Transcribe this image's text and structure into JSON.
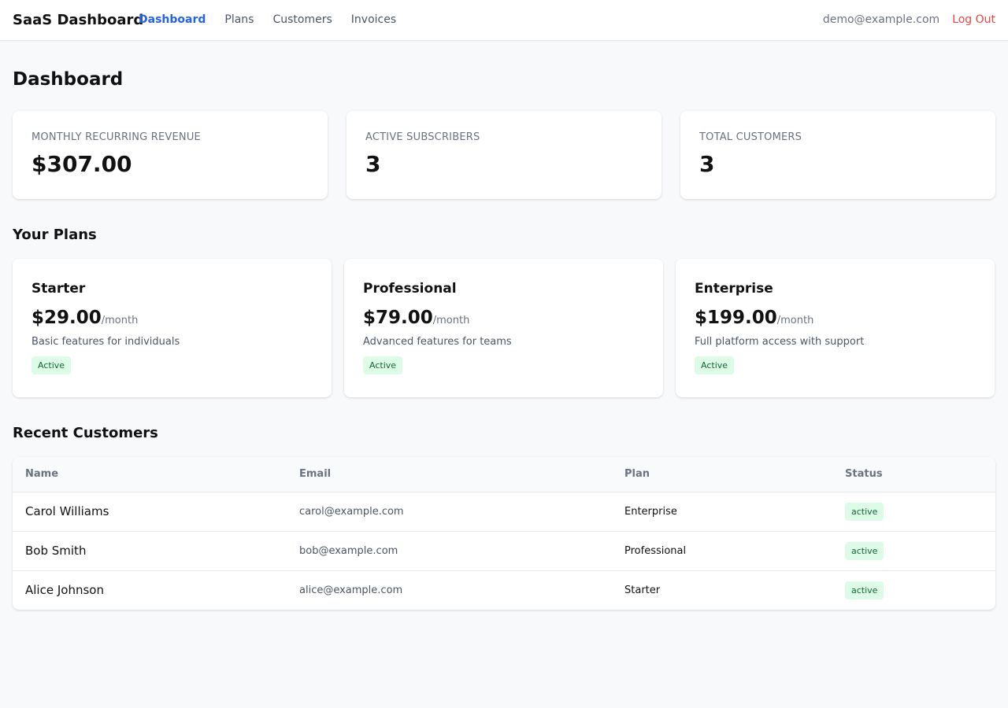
{
  "header": {
    "brand": "SaaS Dashboard",
    "nav": [
      {
        "label": "Dashboard",
        "active": true
      },
      {
        "label": "Plans",
        "active": false
      },
      {
        "label": "Customers",
        "active": false
      },
      {
        "label": "Invoices",
        "active": false
      }
    ],
    "user_email": "demo@example.com",
    "logout_label": "Log Out"
  },
  "page": {
    "title": "Dashboard"
  },
  "stats": [
    {
      "label": "MONTHLY RECURRING REVENUE",
      "value": "$307.00"
    },
    {
      "label": "ACTIVE SUBSCRIBERS",
      "value": "3"
    },
    {
      "label": "TOTAL CUSTOMERS",
      "value": "3"
    }
  ],
  "plans_section": {
    "title": "Your Plans",
    "plans": [
      {
        "name": "Starter",
        "price": "$29.00",
        "period": "/month",
        "description": "Basic features for individuals",
        "status": "Active"
      },
      {
        "name": "Professional",
        "price": "$79.00",
        "period": "/month",
        "description": "Advanced features for teams",
        "status": "Active"
      },
      {
        "name": "Enterprise",
        "price": "$199.00",
        "period": "/month",
        "description": "Full platform access with support",
        "status": "Active"
      }
    ]
  },
  "customers_section": {
    "title": "Recent Customers",
    "columns": [
      "Name",
      "Email",
      "Plan",
      "Status"
    ],
    "rows": [
      {
        "name": "Carol Williams",
        "email": "carol@example.com",
        "plan": "Enterprise",
        "status": "active"
      },
      {
        "name": "Bob Smith",
        "email": "bob@example.com",
        "plan": "Professional",
        "status": "active"
      },
      {
        "name": "Alice Johnson",
        "email": "alice@example.com",
        "plan": "Starter",
        "status": "active"
      }
    ]
  },
  "colors": {
    "accent": "#2563eb",
    "danger": "#ef4444",
    "success_bg": "#dcfce7",
    "success_text": "#166534"
  }
}
